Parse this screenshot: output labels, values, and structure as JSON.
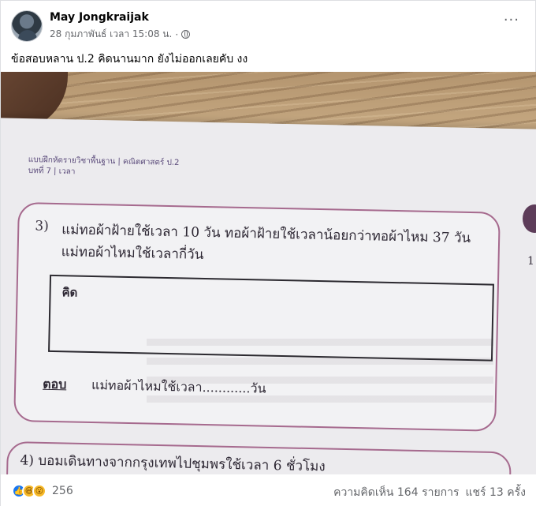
{
  "post": {
    "author": "May Jongkraijak",
    "timestamp": "28 กุมภาพันธ์ เวลา 15:08 น.",
    "separator": "·",
    "privacy_icon": "globe-icon",
    "more_icon": "more-options-icon",
    "more_label": "···",
    "caption": "ข้อสอบหลาน ป.2 คิดนานมาก ยังไม่ออกเลยคับ งง"
  },
  "photo": {
    "book_title": "แบบฝึกหัดรายวิชาพื้นฐาน | คณิตศาสตร์ ป.2",
    "book_chapter": "บทที่ 7 | เวลา",
    "question_number": "3)",
    "question_line1": "แม่ทอผ้าฝ้ายใช้เวลา 10 วัน ทอผ้าฝ้ายใช้เวลาน้อยกว่าทอผ้าไหม 37 วัน",
    "question_line2": "แม่ทอผ้าไหมใช้เวลากี่วัน",
    "think_label": "คิด",
    "answer_label": "ตอบ",
    "answer_text": "แม่ทอผ้าไหมใช้เวลา............วัน",
    "next_question": "4)  บอมเดินทางจากกรุงเทพไปชุมพรใช้เวลา 6 ชั่วโมง",
    "side_char": "1"
  },
  "footer": {
    "reaction_icons": [
      "like-icon",
      "haha-icon",
      "wow-icon"
    ],
    "reaction_glyphs": [
      "👍",
      "😆",
      "😮"
    ],
    "reaction_count": "256",
    "comments": "ความคิดเห็น 164 รายการ",
    "shares": "แชร์ 13 ครั้ง"
  },
  "colors": {
    "like_blue": "#1877f2",
    "box_border": "#a66a8e",
    "meta_gray": "#65676b"
  }
}
